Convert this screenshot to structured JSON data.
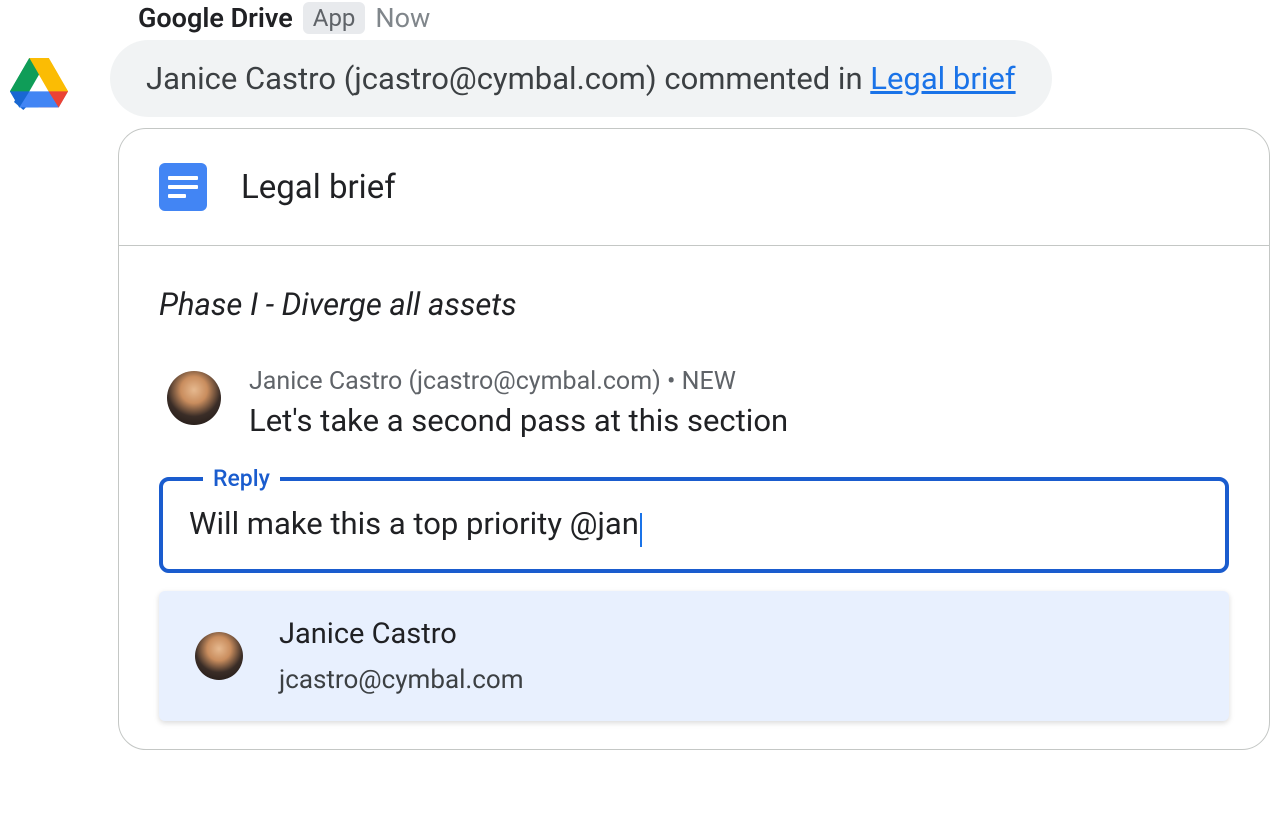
{
  "notification": {
    "app_name": "Google Drive",
    "app_badge": "App",
    "time": "Now",
    "body_prefix": "Janice Castro (jcastro@cymbal.com) commented in ",
    "doc_link_text": "Legal brief"
  },
  "card": {
    "doc_title": "Legal brief",
    "section_heading": "Phase I - Diverge all assets",
    "comment": {
      "author_line": "Janice Castro (jcastro@cymbal.com) • NEW",
      "text": "Let's take a second pass at this section"
    },
    "reply": {
      "label": "Reply",
      "value": "Will make this a top priority @jan"
    },
    "mention_suggestion": {
      "name": "Janice Castro",
      "email": "jcastro@cymbal.com"
    }
  },
  "icons": {
    "drive": "google-drive-icon",
    "docs": "google-docs-icon"
  }
}
